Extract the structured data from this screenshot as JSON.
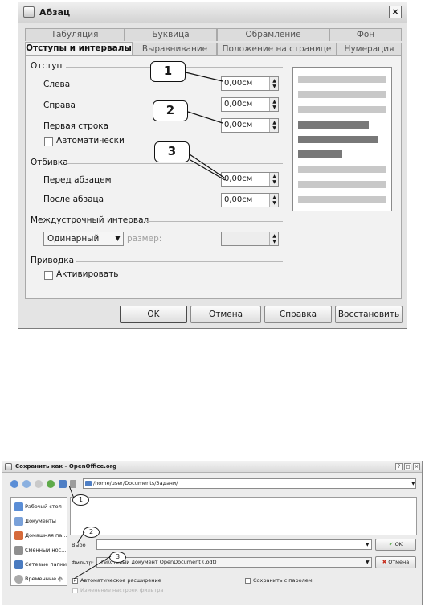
{
  "dialog1": {
    "title": "Абзац",
    "close": "×",
    "tabs_row1": [
      "Табуляция",
      "Буквица",
      "Обрамление",
      "Фон"
    ],
    "tabs_row2": [
      "Отступы и интервалы",
      "Выравнивание",
      "Положение на странице",
      "Нумерация"
    ],
    "indent": {
      "section": "Отступ",
      "before_text": "Слева",
      "before_text_value": "0,00см",
      "after_text": "Справа",
      "after_text_value": "0,00см",
      "first_line": "Первая строка",
      "first_line_value": "0,00см",
      "automatic": "Автоматически"
    },
    "spacing": {
      "section": "Отбивка",
      "above": "Перед абзацем",
      "above_value": "0,00см",
      "below": "После абзаца",
      "below_value": "0,00см"
    },
    "line_spacing": {
      "section": "Междустрочный интервал",
      "mode": "Одинарный",
      "size_label": "размер:"
    },
    "register": {
      "section": "Приводка",
      "activate": "Активировать"
    },
    "buttons": {
      "ok": "OK",
      "cancel": "Отмена",
      "help": "Справка",
      "reset": "Восстановить"
    },
    "callouts": [
      "1",
      "2",
      "3"
    ]
  },
  "dialog2": {
    "title": "Сохранить как - OpenOffice.org",
    "window_buttons": [
      "?",
      "□",
      "×"
    ],
    "path": "/home/user/Documents/Задачи/",
    "places": [
      "Рабочий стол",
      "Документы",
      "Домашняя па...",
      "Сменный нос...",
      "Сетевые папки",
      "Временные ф..."
    ],
    "name_label": "Выбо",
    "name_value": "",
    "filter_label": "Фильтр:",
    "filter_value": "Текстовый документ OpenDocument (.odt)",
    "ok": "OK",
    "cancel": "Отмена",
    "auto_extension": "Автоматическое расширение",
    "save_with_password": "Сохранить с паролем",
    "edit_filter_settings": "Изменение настроек фильтра",
    "callouts": [
      "1",
      "2",
      "3"
    ]
  }
}
